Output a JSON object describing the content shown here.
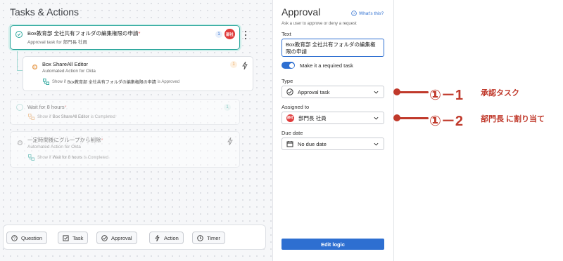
{
  "canvas": {
    "title": "Tasks & Actions",
    "cards": [
      {
        "title": "Box教育部 全社共有フォルダの編集権限の申請",
        "required_mark": "*",
        "subtitle": "Approval task for 部門長 社員",
        "count": "1",
        "avatar_text": "部社"
      },
      {
        "title": "Box ShareAll Editor",
        "subtitle": "Automated Action for Okta",
        "count": "1",
        "condition_prefix": "Show if",
        "condition_target": "Box教育部 全社共有フォルダの編集権限の申請",
        "condition_suffix": "is Approved"
      },
      {
        "title": "Wait for 8 hours",
        "required_mark": "*",
        "count": "1",
        "condition_prefix": "Show if",
        "condition_target": "Box ShareAll Editor",
        "condition_suffix": "is Completed"
      },
      {
        "title": "一定時間後にグループから削除",
        "required_mark": "*",
        "subtitle": "Automated Action for Okta",
        "condition_prefix": "Show if",
        "condition_target": "Wait for 8 hours",
        "condition_suffix": "is Completed"
      }
    ]
  },
  "toolbar": {
    "buttons": [
      {
        "label": "Question",
        "icon": "question-icon"
      },
      {
        "label": "Task",
        "icon": "checkbox-icon"
      },
      {
        "label": "Approval",
        "icon": "check-circle-icon"
      },
      {
        "label": "Action",
        "icon": "bolt-icon"
      },
      {
        "label": "Timer",
        "icon": "clock-icon"
      }
    ]
  },
  "panel": {
    "title": "Approval",
    "whats_this": "What's this?",
    "subtitle": "Ask a user to approve or deny a request",
    "text_label": "Text",
    "text_value": "Box教育部 全社共有フォルダの編集権限の申請",
    "required_toggle": true,
    "required_label": "Make it a required task",
    "type_label": "Type",
    "type_value": "Approval task",
    "assigned_label": "Assigned to",
    "assigned_value": "部門長 社員",
    "assigned_avatar": "部社",
    "due_label": "Due date",
    "due_value": "No due date",
    "edit_button": "Edit logic"
  },
  "annotations": [
    {
      "num": "①－1",
      "text": "承認タスク"
    },
    {
      "num": "①－2",
      "text": "部門長 に割り当て"
    }
  ],
  "colors": {
    "accent": "#2e6fd1",
    "teal": "#2aa69c",
    "orange": "#e8a25a",
    "annotation": "#c0392b",
    "avatar": "#e03b3b"
  }
}
